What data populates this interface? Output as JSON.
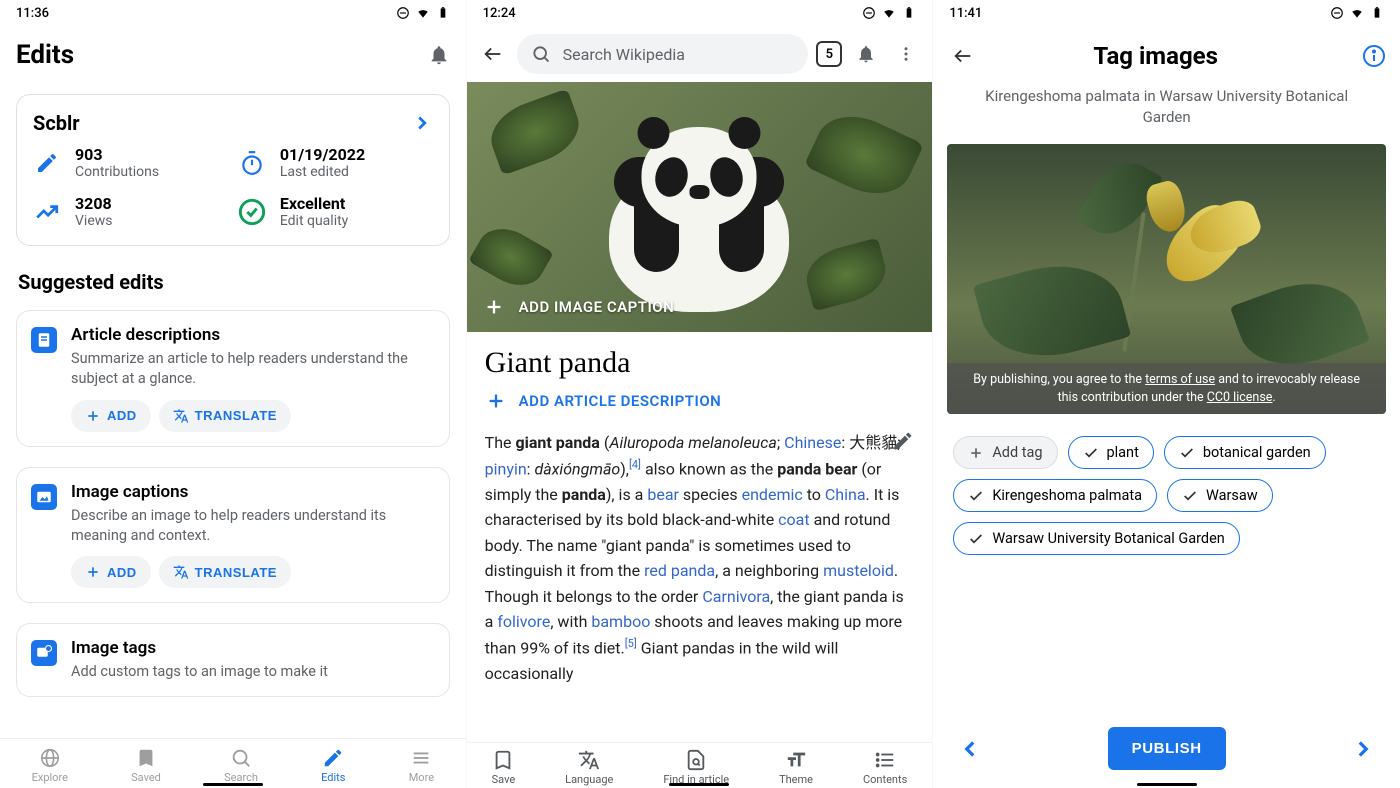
{
  "screen1": {
    "time": "11:36",
    "title": "Edits",
    "user": {
      "name": "Scblr",
      "contributions": {
        "value": "903",
        "label": "Contributions"
      },
      "last_edited": {
        "value": "01/19/2022",
        "label": "Last edited"
      },
      "views": {
        "value": "3208",
        "label": "Views"
      },
      "quality": {
        "value": "Excellent",
        "label": "Edit quality"
      }
    },
    "suggested_heading": "Suggested edits",
    "suggested": [
      {
        "title": "Article descriptions",
        "desc": "Summarize an article to help readers understand the subject at a glance.",
        "add": "ADD",
        "translate": "TRANSLATE"
      },
      {
        "title": "Image captions",
        "desc": "Describe an image to help readers understand its meaning and context.",
        "add": "ADD",
        "translate": "TRANSLATE"
      },
      {
        "title": "Image tags",
        "desc": "Add custom tags to an image to make it"
      }
    ],
    "nav": {
      "explore": "Explore",
      "saved": "Saved",
      "search": "Search",
      "edits": "Edits",
      "more": "More"
    }
  },
  "screen2": {
    "time": "12:24",
    "search_placeholder": "Search Wikipedia",
    "tab_count": "5",
    "add_caption": "ADD IMAGE CAPTION",
    "article_title": "Giant panda",
    "add_description": "ADD ARTICLE DESCRIPTION",
    "body": {
      "p1_a": "The ",
      "p1_b": "giant panda",
      "p1_c": " (",
      "p1_d": "Ailuropoda melanoleuca",
      "p1_e": "; ",
      "p1_chinese": "Chinese",
      "p1_f": ": 大熊貓; ",
      "p1_pinyin": "pinyin",
      "p1_g": ": ",
      "p1_h": "dàxióngmāo",
      "p1_i": "),",
      "p1_ref1": "[4]",
      "p1_j": " also known as the ",
      "p1_k": "panda bear",
      "p1_l": " (or simply the ",
      "p1_m": "panda",
      "p1_n": "), is a ",
      "p1_bear": "bear",
      "p1_o": " species ",
      "p1_endemic": "endemic",
      "p1_p": " to ",
      "p1_china": "China",
      "p1_q": ". It is characterised by its bold black-and-white ",
      "p1_coat": "coat",
      "p1_r": " and rotund body. The name \"giant panda\" is sometimes used to distinguish it from the ",
      "p1_redpanda": "red panda",
      "p1_s": ", a neighboring ",
      "p1_mustel": "musteloid",
      "p1_t": ". Though it belongs to the order ",
      "p1_carn": "Carnivora",
      "p1_u": ", the giant panda is a ",
      "p1_foli": "folivore",
      "p1_v": ", with ",
      "p1_bamboo": "bamboo",
      "p1_w": " shoots and leaves making up more than 99% of its diet.",
      "p1_ref2": "[5]",
      "p1_x": " Giant pandas in the wild will occasionally"
    },
    "nav": {
      "save": "Save",
      "language": "Language",
      "find": "Find in article",
      "theme": "Theme",
      "contents": "Contents"
    }
  },
  "screen3": {
    "time": "11:41",
    "title": "Tag images",
    "subtitle": "Kirengeshoma palmata in Warsaw University Botanical Garden",
    "photo_caption_a": "By publishing, you agree to the ",
    "photo_caption_terms": "terms of use",
    "photo_caption_b": " and to irrevocably release this contribution under the ",
    "photo_caption_cc0": "CC0 license",
    "photo_caption_c": ".",
    "add_tag": "Add tag",
    "tags": [
      "plant",
      "botanical garden",
      "Kirengeshoma palmata",
      "Warsaw",
      "Warsaw University Botanical Garden"
    ],
    "publish": "PUBLISH"
  }
}
